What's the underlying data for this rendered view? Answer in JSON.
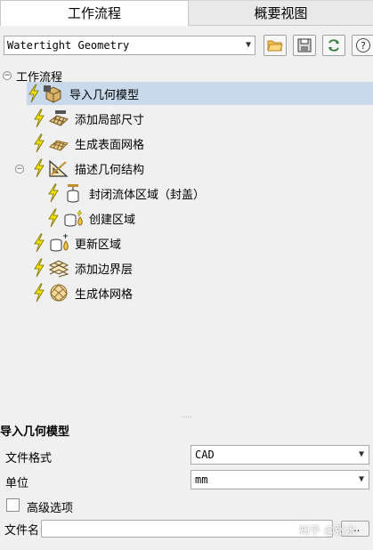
{
  "tabs": [
    {
      "label": "工作流程",
      "active": true
    },
    {
      "label": "概要视图",
      "active": false
    }
  ],
  "toolbar": {
    "workflow_select": "Watertight Geometry",
    "buttons": [
      "open-folder-icon",
      "save-icon",
      "refresh-icon",
      "help-icon"
    ],
    "help_glyph": "?"
  },
  "tree": {
    "root": "工作流程",
    "items": [
      {
        "label": "导入几何模型",
        "icon": "import-geometry-icon",
        "selected": true
      },
      {
        "label": "添加局部尺寸",
        "icon": "local-sizing-icon"
      },
      {
        "label": "生成表面网格",
        "icon": "surface-mesh-icon"
      },
      {
        "label": "描述几何结构",
        "icon": "describe-geometry-icon",
        "expanded": true
      },
      {
        "label": "封闭流体区域（封盖）",
        "icon": "capping-icon",
        "child": true
      },
      {
        "label": "创建区域",
        "icon": "create-region-icon",
        "child": true
      },
      {
        "label": "更新区域",
        "icon": "update-region-icon"
      },
      {
        "label": "添加边界层",
        "icon": "boundary-layer-icon"
      },
      {
        "label": "生成体网格",
        "icon": "volume-mesh-icon"
      }
    ]
  },
  "properties": {
    "title": "导入几何模型",
    "file_format_label": "文件格式",
    "file_format_value": "CAD",
    "units_label": "单位",
    "units_value": "mm",
    "advanced_label": "高级选项",
    "filename_label": "文件名",
    "browse_label": "..."
  },
  "watermark": "知乎 @张水",
  "colors": {
    "selection": "#c9d9ec",
    "bolt": "#f2e200",
    "background": "#f0f0f0"
  }
}
